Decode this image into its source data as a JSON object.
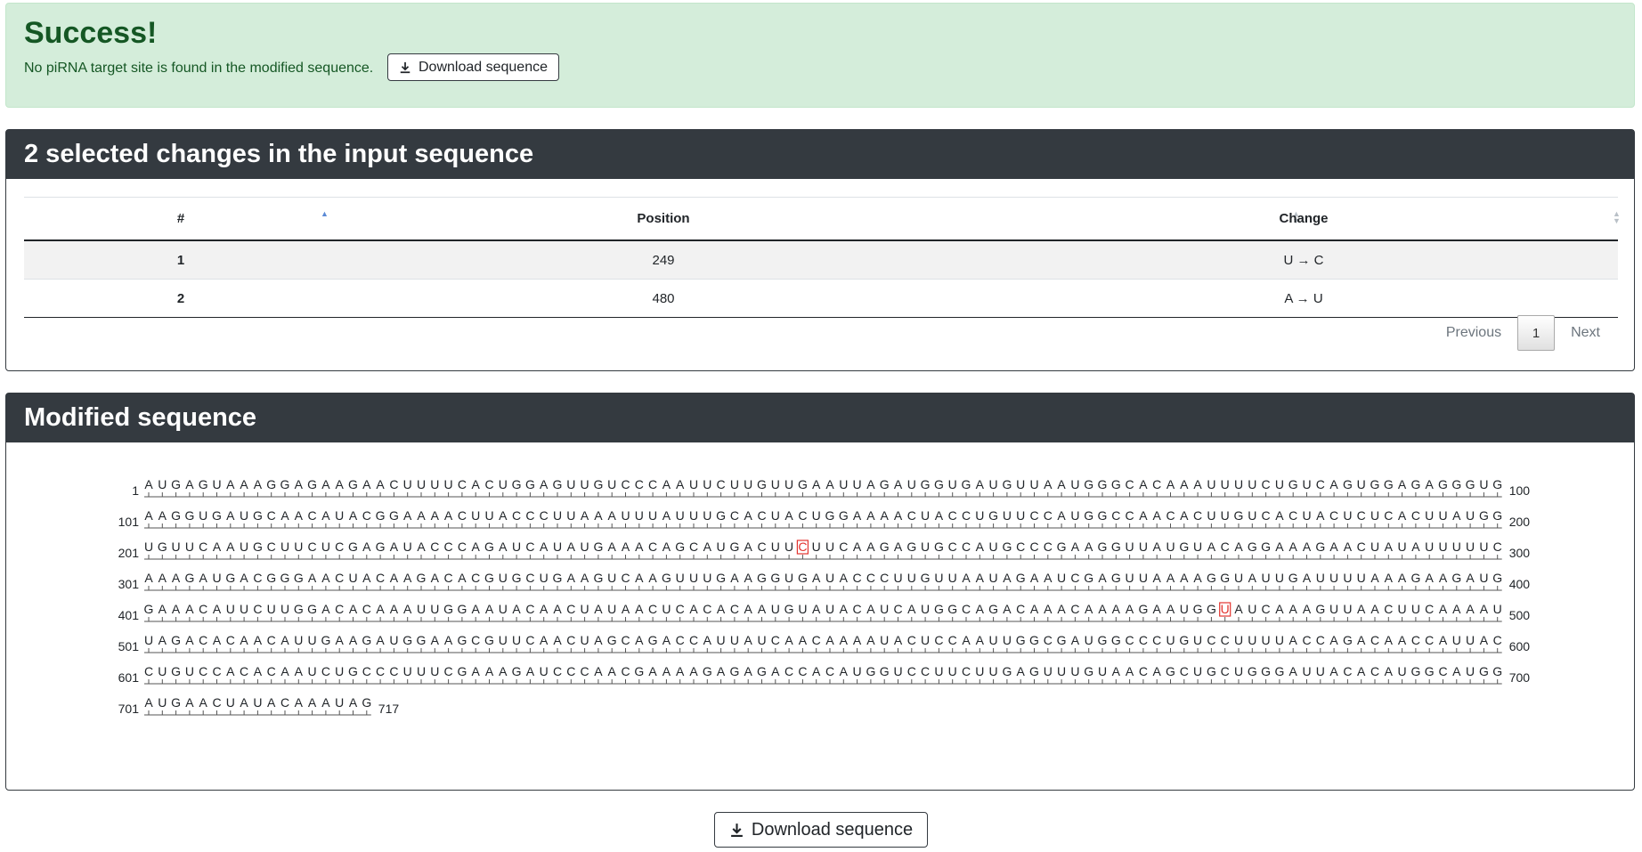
{
  "alert": {
    "heading": "Success!",
    "message": "No piRNA target site is found in the modified sequence.",
    "download_label": "Download sequence",
    "color": "#155724",
    "background": "#d4edda"
  },
  "changes": {
    "title": "2 selected changes in the input sequence",
    "columns": [
      "#",
      "Position",
      "Change"
    ],
    "rows": [
      {
        "idx": "1",
        "position": "249",
        "change": "U → C"
      },
      {
        "idx": "2",
        "position": "480",
        "change": "A → U"
      }
    ],
    "pagination": {
      "previous": "Previous",
      "current": "1",
      "next": "Next"
    }
  },
  "sequence": {
    "title": "Modified sequence",
    "line_length": 100,
    "highlight_color": "#e3342f",
    "highlights": [
      249,
      480
    ],
    "total_length": "717",
    "lines": [
      {
        "start": "1",
        "end": "100",
        "seq": "AUGAGUAAAGGAGAAGAACUUUUCACUGGAGUUGUCCCAAUUCUUGUUGAAUUAGAUGGUGAUGUUAAUGGGCACAAAUUUUCUGUCAGUGGAGAGGGUG"
      },
      {
        "start": "101",
        "end": "200",
        "seq": "AAGGUGAUGCAACAUACGGAAAACUUACCCUUAAAUUUAUUUGCACUACUGGAAAACUACCUGUUCCAUGGCCAACACUUGUCACUACUCUCACUUAUGG"
      },
      {
        "start": "201",
        "end": "300",
        "seq": "UGUUCAAUGCUUCUCGAGAUACCCAGAUCAUAUGAAACAGCAUGACUUCUUCAAGAGUGCCAUGCCCGAAGGUUAUGUACAGGAAAGAACUAUAUUUUUC"
      },
      {
        "start": "301",
        "end": "400",
        "seq": "AAAGAUGACGGGAACUACAAGACACGUGCUGAAGUCAAGUUUGAAGGUGAUACCCUUGUUAAUAGAAUCGAGUUAAAAGGUAUUGAUUUUAAAGAAGAUG"
      },
      {
        "start": "401",
        "end": "500",
        "seq": "GAAACAUUCUUGGACACAAAUUGGAAUACAACUAUAACUCACACAAUGUAUACAUCAUGGCAGACAAACAAAAGAAUGGUAUCAAAGUUAACUUCAAAAU"
      },
      {
        "start": "501",
        "end": "600",
        "seq": "UAGACACAACAUUGAAGAUGGAAGCGUUCAACUAGCAGACCAUUAUCAACAAAAUACUCCAAUUGGCGAUGGCCCUGUCCUUUUACCAGACAACCAUUAC"
      },
      {
        "start": "601",
        "end": "700",
        "seq": "CUGUCCACACAAUCUGCCCUUUCGAAAGAUCCCAACGAAAAGAGAGACCACAUGGUCCUUCUUGAGUUUGUAACAGCUGCUGGGAUUACACAUGGCAUGG"
      },
      {
        "start": "701",
        "end": "717",
        "seq": "AUGAACUAUACAAAUAG"
      }
    ]
  },
  "footer": {
    "download_label": "Download sequence"
  }
}
